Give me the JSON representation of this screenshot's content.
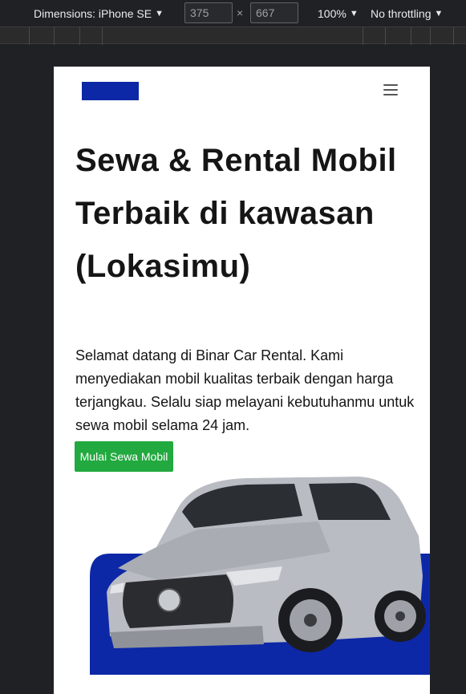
{
  "devtools": {
    "dimensions_label": "Dimensions: iPhone SE",
    "width": "375",
    "height": "667",
    "times": "×",
    "zoom": "100%",
    "throttling": "No throttling",
    "caret": "▼"
  },
  "navbar": {
    "logo_color": "#0d28a6",
    "menu_icon": "hamburger-menu-icon"
  },
  "hero": {
    "title": "Sewa & Rental Mobil Terbaik di kawasan (Lokasimu)",
    "description": "Selamat datang di Binar Car Rental. Kami menyediakan mobil kualitas terbaik dengan harga terjangkau. Selalu siap melayani kebutuhanmu untuk sewa mobil selama 24 jam.",
    "cta_label": "Mulai Sewa Mobil",
    "cta_color": "#22a93f",
    "backdrop_color": "#0d28a6"
  }
}
